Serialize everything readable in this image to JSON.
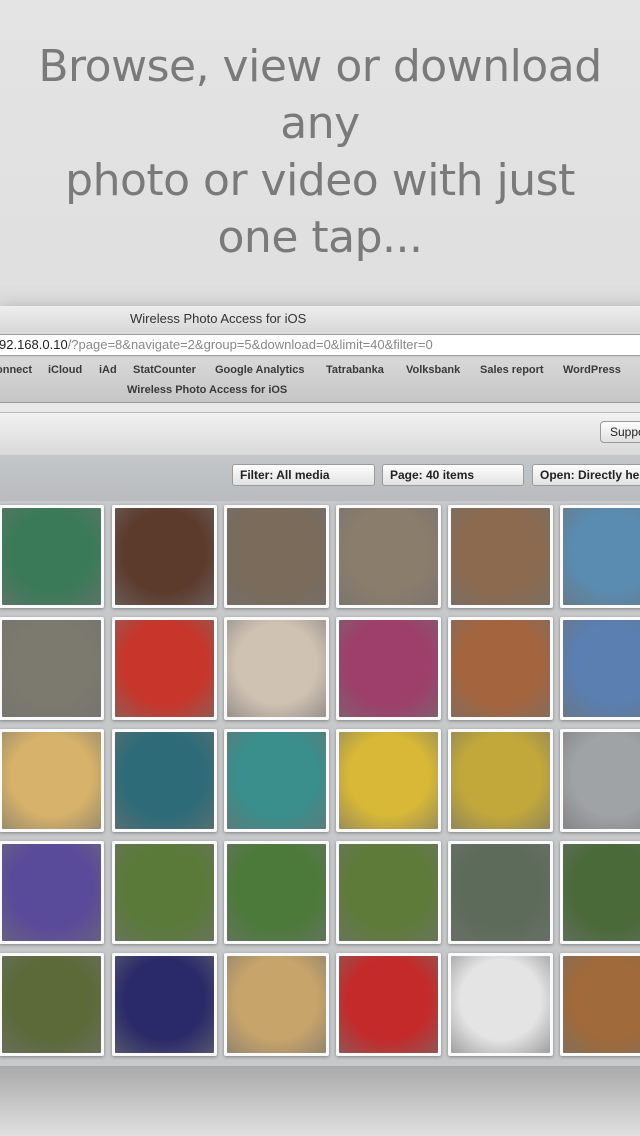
{
  "headline": {
    "line1": "Browse, view or download any",
    "line2": "photo or video with just",
    "line3": "one tap..."
  },
  "browser": {
    "window_title": "Wireless Photo Access for iOS",
    "url_host": "92.168.0.10",
    "url_rest": "/?page=8&navigate=2&group=5&download=0&limit=40&filter=0",
    "bookmarks": [
      "onnect",
      "iCloud",
      "iAd",
      "StatCounter",
      "Google Analytics",
      "Tatrabanka",
      "Volksbank",
      "Sales report",
      "WordPress"
    ],
    "tab_title": "Wireless Photo Access for iOS"
  },
  "page": {
    "support_label": "Suppo",
    "filter_label": "Filter: All media",
    "page_label": "Page: 40 items",
    "open_label": "Open: Directly here"
  },
  "photos": [
    [
      "#3b7a58",
      "#5c3a2c",
      "#7a6b5a",
      "#8a7d6c",
      "#8b6a4f",
      "#5a8bb0"
    ],
    [
      "#7c7a6e",
      "#c8352a",
      "#d0c2b2",
      "#9e3e6a",
      "#a4643e",
      "#5a7fb0"
    ],
    [
      "#d7b26a",
      "#2d6b78",
      "#3a8e8c",
      "#d8b836",
      "#c2a83a",
      "#a0a3a6"
    ],
    [
      "#5a4a9a",
      "#5a7a3a",
      "#4c7a3a",
      "#5e7b3a",
      "#5d6c5a",
      "#4a6a3a"
    ],
    [
      "#5c6a3a",
      "#2a2a6a",
      "#c7a46a",
      "#c42a2a",
      "#e4e4e4",
      "#a06a3a"
    ]
  ]
}
